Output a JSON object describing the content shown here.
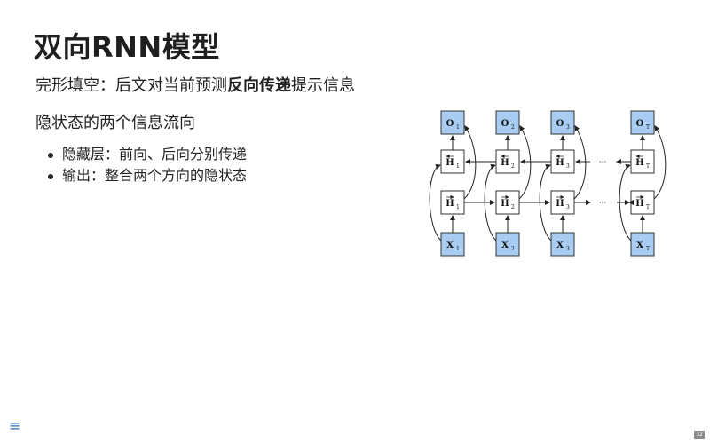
{
  "slide": {
    "title": "双向RNN模型",
    "subtitle": {
      "prefix": "完形填空：后文对当前预测",
      "emphasis": "反向传递",
      "suffix": "提示信息"
    },
    "section_heading": "隐状态的两个信息流向",
    "bullets": [
      "隐藏层：前向、后向分别传递",
      "输出：整合两个方向的隐状态"
    ]
  },
  "diagram": {
    "outputs": [
      "O",
      "O",
      "O",
      "O"
    ],
    "output_subs": [
      "1",
      "2",
      "3",
      "T"
    ],
    "backward_hidden": [
      "H",
      "H",
      "H",
      "H"
    ],
    "forward_hidden": [
      "H",
      "H",
      "H",
      "H"
    ],
    "hidden_subs": [
      "1",
      "2",
      "3",
      "T"
    ],
    "inputs": [
      "X",
      "X",
      "X",
      "X"
    ],
    "input_subs": [
      "1",
      "2",
      "3",
      "T"
    ],
    "ellipsis": "···",
    "colors": {
      "io_fill": "#a9cdf2",
      "box_stroke": "#333333"
    }
  },
  "nav": {
    "menu_icon": "hamburger-icon",
    "menu_glyph": "≡",
    "page_number": "32"
  }
}
